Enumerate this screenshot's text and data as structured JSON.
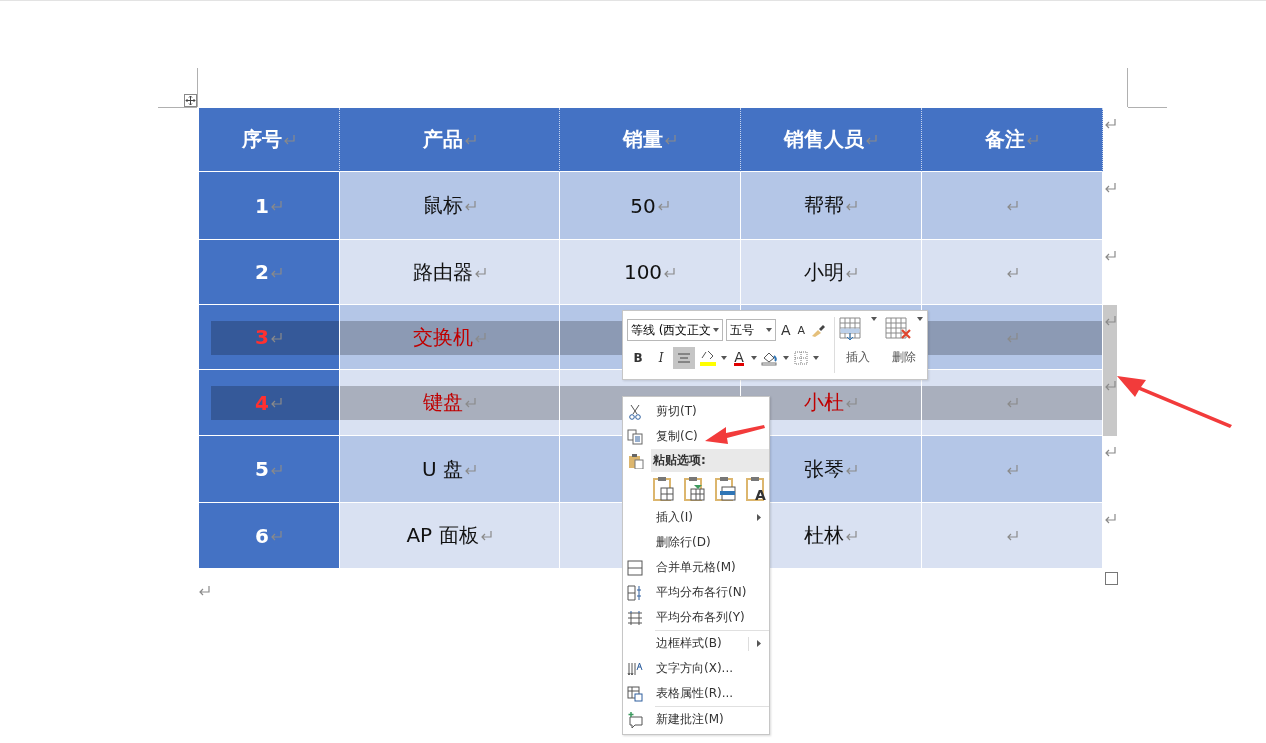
{
  "table": {
    "columns": [
      "序号",
      "产品",
      "销量",
      "销售人员",
      "备注"
    ],
    "rows": [
      {
        "selected": false,
        "cells": [
          {
            "text": "1"
          },
          {
            "text": "鼠标"
          },
          {
            "text": "50"
          },
          {
            "text": "帮帮"
          },
          {}
        ]
      },
      {
        "selected": false,
        "cells": [
          {
            "text": "2"
          },
          {
            "text": "路由器"
          },
          {
            "text": "100"
          },
          {
            "text": "小明"
          },
          {}
        ]
      },
      {
        "selected": true,
        "cells": [
          {
            "text": "3"
          },
          {
            "text": "交换机"
          },
          {},
          {},
          {}
        ]
      },
      {
        "selected": true,
        "cells": [
          {
            "text": "4"
          },
          {
            "text": "键盘"
          },
          {},
          {
            "text": "小杜"
          },
          {}
        ]
      },
      {
        "selected": false,
        "cells": [
          {
            "text": "5"
          },
          {
            "text": "U 盘"
          },
          {},
          {
            "text": "张琴"
          },
          {}
        ]
      },
      {
        "selected": false,
        "cells": [
          {
            "text": "6"
          },
          {
            "text": "AP 面板"
          },
          {},
          {
            "text": "杜林"
          },
          {}
        ]
      }
    ]
  },
  "mini_toolbar": {
    "font": "等线 (西文正文",
    "size": "五号",
    "grow_font": "A",
    "shrink_font": "A",
    "buttons": [
      {
        "kind": "bold",
        "label": "B",
        "selected": false
      },
      {
        "kind": "italic",
        "label": "I",
        "selected": false
      },
      {
        "kind": "center",
        "selected": true
      },
      {
        "kind": "highlight",
        "selected": false
      },
      {
        "kind": "font_color",
        "label": "A",
        "selected": false
      },
      {
        "kind": "shading",
        "selected": false
      },
      {
        "kind": "borders",
        "selected": false
      }
    ],
    "insert": "插入",
    "delete": "删除"
  },
  "context_menu": [
    {
      "kind": "cut",
      "label": "剪切(T)"
    },
    {
      "kind": "copy",
      "label": "复制(C)"
    },
    {
      "kind": "paste_header",
      "label": "粘贴选项:"
    },
    {
      "kind": "paste_options",
      "text_only": "A"
    },
    {
      "kind": "insert",
      "label": "插入(I)",
      "submenu": true
    },
    {
      "kind": "delete_row",
      "label": "删除行(D)"
    },
    {
      "kind": "merge",
      "label": "合并单元格(M)"
    },
    {
      "kind": "distribute_rows",
      "label": "平均分布各行(N)"
    },
    {
      "kind": "distribute_cols",
      "label": "平均分布各列(Y)"
    },
    {
      "kind": "separator"
    },
    {
      "kind": "borders",
      "label": "边框样式(B)",
      "submenu": true
    },
    {
      "kind": "text_direction",
      "label": "文字方向(X)..."
    },
    {
      "kind": "table_properties",
      "label": "表格属性(R)..."
    },
    {
      "kind": "separator"
    },
    {
      "kind": "comment",
      "label": "新建批注(M)"
    }
  ]
}
